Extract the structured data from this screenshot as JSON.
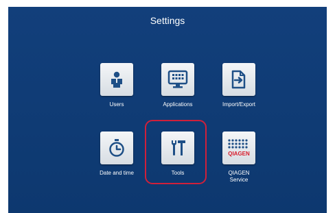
{
  "screen": {
    "title": "Settings"
  },
  "tiles": [
    {
      "label": "Users",
      "icon": "user-icon"
    },
    {
      "label": "Applications",
      "icon": "monitor-icon"
    },
    {
      "label": "Import/Export",
      "icon": "document-import-icon"
    },
    {
      "label": "Date and time",
      "icon": "timer-icon"
    },
    {
      "label": "Tools",
      "icon": "tools-icon"
    },
    {
      "label": "QIAGEN Service",
      "icon": "qiagen-logo"
    }
  ],
  "qiagen_logo_text": "QIAGEN",
  "colors": {
    "background": "#0f3a74",
    "highlight": "#d0203a",
    "icon": "#1e4f86",
    "qiagen_red": "#d81b2a"
  }
}
